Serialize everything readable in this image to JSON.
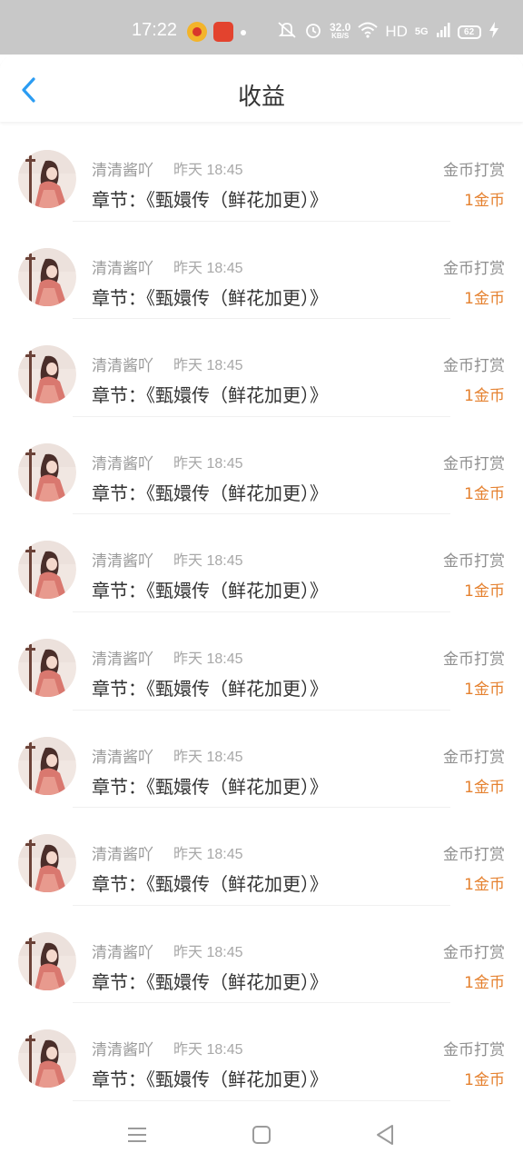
{
  "status_bar": {
    "time": "17:22",
    "network_speed_value": "32.0",
    "network_speed_unit": "KB/S",
    "hd_label": "HD",
    "network_type": "5G",
    "battery": "62",
    "icons": [
      "weibo-icon",
      "app-icon",
      "mute-icon",
      "alarm-icon",
      "wifi-icon",
      "signal-icon",
      "battery-icon",
      "charging-icon"
    ]
  },
  "header": {
    "title": "收益",
    "back_icon": "chevron-left-icon",
    "accent_color": "#2b9cf2"
  },
  "records": [
    {
      "name": "清清酱吖",
      "time": "昨天 18:45",
      "chapter": "章节：《甄嬛传（鲜花加更）》",
      "type": "金币打赏",
      "amount": "1金币"
    },
    {
      "name": "清清酱吖",
      "time": "昨天 18:45",
      "chapter": "章节：《甄嬛传（鲜花加更）》",
      "type": "金币打赏",
      "amount": "1金币"
    },
    {
      "name": "清清酱吖",
      "time": "昨天 18:45",
      "chapter": "章节：《甄嬛传（鲜花加更）》",
      "type": "金币打赏",
      "amount": "1金币"
    },
    {
      "name": "清清酱吖",
      "time": "昨天 18:45",
      "chapter": "章节：《甄嬛传（鲜花加更）》",
      "type": "金币打赏",
      "amount": "1金币"
    },
    {
      "name": "清清酱吖",
      "time": "昨天 18:45",
      "chapter": "章节：《甄嬛传（鲜花加更）》",
      "type": "金币打赏",
      "amount": "1金币"
    },
    {
      "name": "清清酱吖",
      "time": "昨天 18:45",
      "chapter": "章节：《甄嬛传（鲜花加更）》",
      "type": "金币打赏",
      "amount": "1金币"
    },
    {
      "name": "清清酱吖",
      "time": "昨天 18:45",
      "chapter": "章节：《甄嬛传（鲜花加更）》",
      "type": "金币打赏",
      "amount": "1金币"
    },
    {
      "name": "清清酱吖",
      "time": "昨天 18:45",
      "chapter": "章节：《甄嬛传（鲜花加更）》",
      "type": "金币打赏",
      "amount": "1金币"
    },
    {
      "name": "清清酱吖",
      "time": "昨天 18:45",
      "chapter": "章节：《甄嬛传（鲜花加更）》",
      "type": "金币打赏",
      "amount": "1金币"
    },
    {
      "name": "清清酱吖",
      "time": "昨天 18:45",
      "chapter": "章节：《甄嬛传（鲜花加更）》",
      "type": "金币打赏",
      "amount": "1金币"
    }
  ],
  "colors": {
    "amount": "#e5812f",
    "status_bar_bg": "#c8c8c8"
  },
  "nav_bar": {
    "icons": [
      "menu-icon",
      "home-square-icon",
      "back-triangle-icon"
    ]
  }
}
